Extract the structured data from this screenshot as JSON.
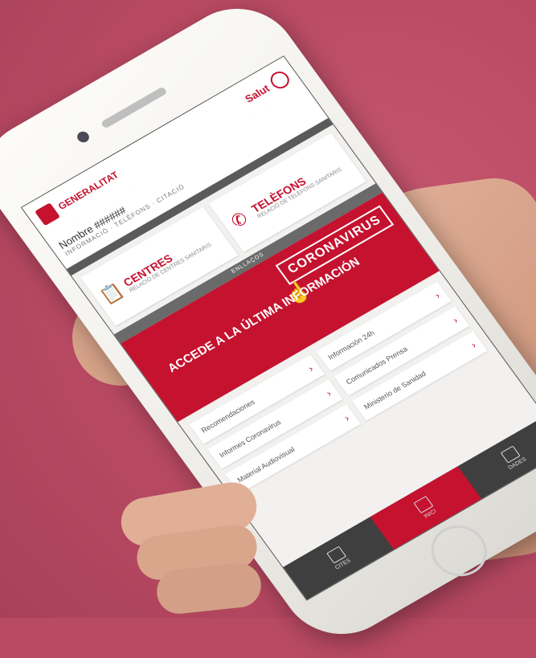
{
  "header": {
    "brand_right": "Salut",
    "brand_left": "GENERALITAT"
  },
  "user": {
    "name": "Nombre ######",
    "subtitle": "INFORMACIÓ · TELÈFONS · CITACIÓ"
  },
  "cards": [
    {
      "title": "CENTRES",
      "subtitle": "RELACIÓ DE CENTRES SANITARIS",
      "icon": "clipboard-icon"
    },
    {
      "title": "TELÈFONS",
      "subtitle": "RELACIÓ DE TELÈFONS SANITARIS",
      "icon": "phone-icon"
    }
  ],
  "section": {
    "label": "ENLLAÇOS"
  },
  "banner": {
    "badge": "CORONAVIRUS",
    "headline": "ACCEDE A LA ÚLTIMA INFORMACIÓN"
  },
  "links": [
    "Recomendaciones",
    "Información 24h",
    "Informes Coronavirus",
    "Comunicados Prensa",
    "Material Audiovisual",
    "Ministerio de Sanidad"
  ],
  "tabs": [
    {
      "label": "CITES"
    },
    {
      "label": "INICI"
    },
    {
      "label": "DADES"
    }
  ],
  "colors": {
    "accent": "#c4122f",
    "background": "#b94a63"
  }
}
